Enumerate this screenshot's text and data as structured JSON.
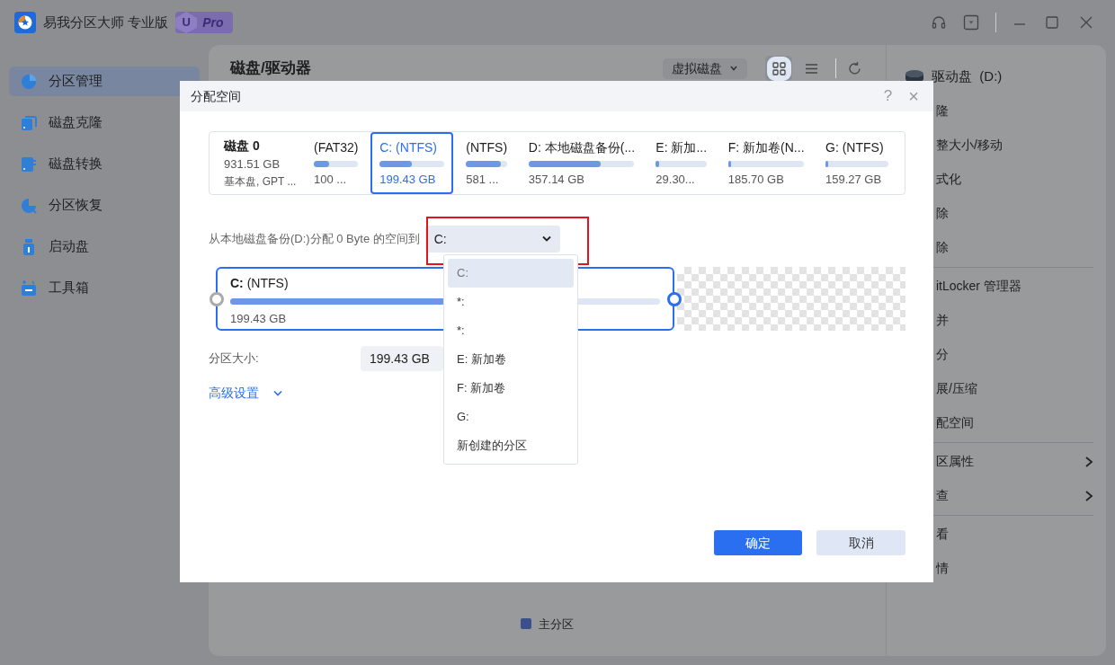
{
  "app": {
    "title": "易我分区大师 专业版",
    "badge_letter": "U",
    "badge": "Pro"
  },
  "sidebar": [
    {
      "label": "分区管理",
      "selected": true,
      "kind": "pie"
    },
    {
      "label": "磁盘克隆",
      "selected": false,
      "kind": "clone"
    },
    {
      "label": "磁盘转换",
      "selected": false,
      "kind": "convert"
    },
    {
      "label": "分区恢复",
      "selected": false,
      "kind": "recover"
    },
    {
      "label": "启动盘",
      "selected": false,
      "kind": "usb"
    },
    {
      "label": "工具箱",
      "selected": false,
      "kind": "toolbox"
    }
  ],
  "main": {
    "heading": "磁盘/驱动器",
    "virtual_menu": "虚拟磁盘",
    "views": [
      {
        "kind": "grid",
        "selected": true
      },
      {
        "kind": "list",
        "selected": false
      }
    ],
    "legend": [
      {
        "label": "主分区",
        "color": "#3a4f8c"
      }
    ]
  },
  "drive_panel": {
    "title": "驱动盘",
    "letter": "(D:)",
    "groups": [
      [
        {
          "label": "隆",
          "submenu": false
        },
        {
          "label": "整大小/移动",
          "submenu": false
        },
        {
          "label": "式化",
          "submenu": false
        },
        {
          "label": "除",
          "submenu": false
        },
        {
          "label": "除",
          "submenu": false
        }
      ],
      [
        {
          "label": "itLocker 管理器",
          "submenu": false
        },
        {
          "label": "并",
          "submenu": false
        },
        {
          "label": "分",
          "submenu": false
        },
        {
          "label": "展/压缩",
          "submenu": false
        },
        {
          "label": "配空间",
          "submenu": false
        }
      ],
      [
        {
          "label": "区属性",
          "submenu": true
        },
        {
          "label": "查",
          "submenu": true
        }
      ],
      [
        {
          "label": "看",
          "submenu": false
        },
        {
          "label": "情",
          "submenu": false
        }
      ]
    ]
  },
  "dialog": {
    "title": "分配空间",
    "help": "?",
    "close": "×",
    "disk": {
      "name": "磁盘 0",
      "size": "931.51 GB",
      "type": "基本盘, GPT ..."
    },
    "partitions": [
      {
        "name": "(FAT32)",
        "size": "100 ...",
        "level": 0.35,
        "selected": false
      },
      {
        "name": "C: (NTFS)",
        "size": "199.43 GB",
        "level": 0.5,
        "selected": true
      },
      {
        "name": "(NTFS)",
        "size": "581 ...",
        "level": 0.85,
        "selected": false
      },
      {
        "name": "D: 本地磁盘备份(...",
        "size": "357.14 GB",
        "level": 0.68,
        "selected": false
      },
      {
        "name": "E: 新加...",
        "size": "29.30...",
        "level": 0.06,
        "selected": false
      },
      {
        "name": "F: 新加卷(N...",
        "size": "185.70 GB",
        "level": 0.04,
        "selected": false
      },
      {
        "name": "G: (NTFS)",
        "size": "159.27 GB",
        "level": 0.04,
        "selected": false
      }
    ],
    "allocate_label": "从本地磁盘备份(D:)分配 0 Byte 的空间到",
    "target": "C:",
    "annotated": true,
    "options": [
      {
        "label": "C:",
        "selected": true
      },
      {
        "label": "*:",
        "selected": false
      },
      {
        "label": "*:",
        "selected": false
      },
      {
        "label": "E: 新加卷",
        "selected": false
      },
      {
        "label": "F: 新加卷",
        "selected": false
      },
      {
        "label": "G:",
        "selected": false
      },
      {
        "label": "新创建的分区",
        "selected": false
      }
    ],
    "editor": {
      "name": "**C:** (NTFS)",
      "size": "199.43 GB",
      "level": 0.5
    },
    "size_label": "分区大小:",
    "size_value": "199.43 GB",
    "advanced": "高级设置",
    "ok": "确定",
    "cancel": "取消"
  }
}
